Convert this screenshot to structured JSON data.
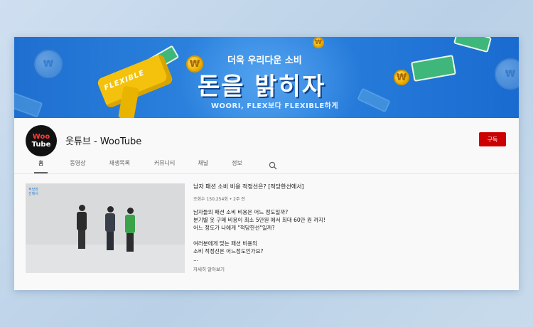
{
  "banner": {
    "subtitle": "더욱 우리다운 소비",
    "title": "돈을 밝히자",
    "tagline": "WOORI, FLEX보다 FLEXIBLE하게",
    "gun_label": "FLEXIBLE",
    "coin_symbol": "₩"
  },
  "channel": {
    "avatar_line1": "Woo",
    "avatar_line2": "Tube",
    "name": "웃튜브 - WooTube",
    "subscribe_label": "구독"
  },
  "tabs": [
    {
      "label": "홈",
      "active": true
    },
    {
      "label": "동영상",
      "active": false
    },
    {
      "label": "재생목록",
      "active": false
    },
    {
      "label": "커뮤니티",
      "active": false
    },
    {
      "label": "채널",
      "active": false
    },
    {
      "label": "정보",
      "active": false
    }
  ],
  "icons": {
    "search": "search-icon"
  },
  "video": {
    "thumb_logo_line1": "적당한",
    "thumb_logo_line2": "선에서",
    "title": "남자 패션 소비 비용 적정선은? [적당한선에서]",
    "meta": "조회수 150,254회 • 2주 전",
    "description": [
      "남자들의 패션 소비 비용은 어느 정도일까?",
      "분기별 옷 구매 비용이 최소 5만원 에서 최대 60만 원 까지!",
      "어느 정도가 나에게 \"적당한선\"일까?",
      "",
      "여러분에게 맞는 패션 비용의",
      "소비 적정선은 어느정도인가요?",
      "..."
    ],
    "more_label": "자세히 알아보기"
  },
  "colors": {
    "banner_blue": "#1f6fd0",
    "subscribe_red": "#cc0000",
    "coin_gold": "#f0b400",
    "bill_green": "#3fb67a"
  }
}
